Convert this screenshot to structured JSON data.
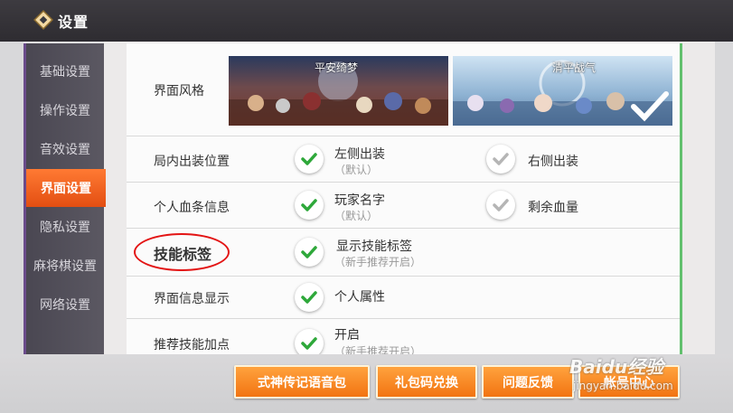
{
  "header": {
    "title": "设置"
  },
  "sidebar": {
    "items": [
      {
        "label": "基础设置",
        "active": false
      },
      {
        "label": "操作设置",
        "active": false
      },
      {
        "label": "音效设置",
        "active": false
      },
      {
        "label": "界面设置",
        "active": true
      },
      {
        "label": "隐私设置",
        "active": false
      },
      {
        "label": "麻将棋设置",
        "active": false
      },
      {
        "label": "网络设置",
        "active": false
      }
    ]
  },
  "settings": {
    "theme": {
      "label": "界面风格",
      "options": [
        {
          "name": "平安绮梦",
          "selected": false
        },
        {
          "name": "清平战气",
          "selected": true
        }
      ]
    },
    "equip_position": {
      "label": "局内出装位置",
      "left_title": "左侧出装",
      "left_sub": "（默认）",
      "left_checked": true,
      "right_title": "右侧出装",
      "right_checked": false
    },
    "hp_info": {
      "label": "个人血条信息",
      "left_title": "玩家名字",
      "left_sub": "（默认）",
      "left_checked": true,
      "right_title": "剩余血量",
      "right_checked": false
    },
    "skill_tag": {
      "label": "技能标签",
      "left_title": "显示技能标签",
      "left_sub": "（新手推荐开启）",
      "left_checked": true
    },
    "ui_info": {
      "label": "界面信息显示",
      "left_title": "个人属性",
      "left_checked": true
    },
    "recommend_skill": {
      "label": "推荐技能加点",
      "left_title": "开启",
      "left_sub": "（新手推荐开启）",
      "left_checked": true
    }
  },
  "bottom_buttons": {
    "voice_pack": "式神传记语音包",
    "gift_code": "礼包码兑换",
    "feedback": "问题反馈",
    "account": "帐号中心"
  },
  "watermark": {
    "brand": "Baidu经验",
    "url": "jingyan.baidu.com"
  },
  "colors": {
    "accent": "#f27412",
    "check": "#2ea83a",
    "check_off": "#b5b5b5",
    "annotation": "#e31414"
  }
}
